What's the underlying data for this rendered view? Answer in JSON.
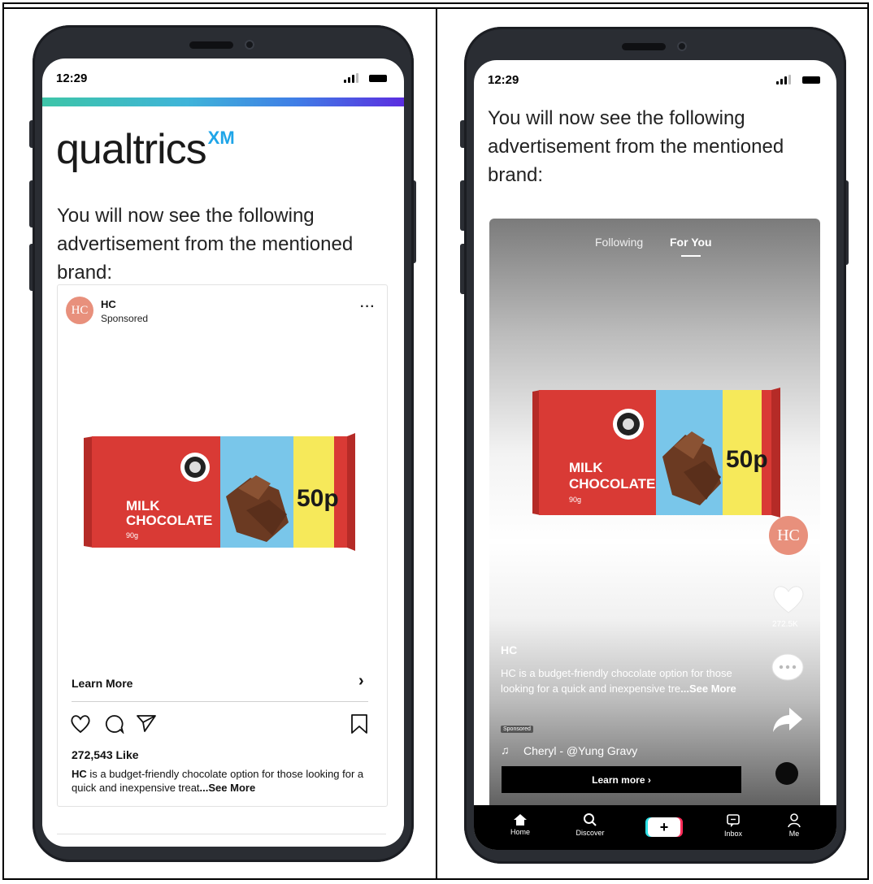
{
  "left_phone": {
    "status_time": "12:29",
    "logo": {
      "word": "qualtrics",
      "superscript": "XM"
    },
    "intro_text": "You will now see the following advertisement from the mentioned brand:",
    "post": {
      "brand_name": "HC",
      "sponsored_label": "Sponsored",
      "avatar_initials": "HC",
      "more_icon": "···",
      "product": {
        "line1": "MILK",
        "line2": "CHOCOLATE",
        "weight": "90g",
        "price": "50p"
      },
      "learn_more": "Learn More",
      "chevron": "›",
      "likes": "272,543 Like",
      "caption_brand": "HC",
      "caption_text": " is a budget-friendly chocolate option for those looking for a quick and inexpensive treat",
      "caption_more": "...See More"
    }
  },
  "right_phone": {
    "status_time": "12:29",
    "intro_text": "You will now see the following advertisement from the mentioned brand:",
    "tabs": {
      "following": "Following",
      "for_you": "For You"
    },
    "product": {
      "line1": "MILK",
      "line2": "CHOCOLATE",
      "weight": "90g",
      "price": "50p"
    },
    "avatar_initials": "HC",
    "like_count": "272.5K",
    "author": "HC",
    "caption": "HC is a budget-friendly chocolate option for those looking for a quick and inexpensive tre",
    "caption_more": "...See More",
    "sponsored_badge": "Sponsored",
    "music": "Cheryl - @Yung Gravy",
    "learn_more": "Learn more ›",
    "nav": {
      "home": "Home",
      "discover": "Discover",
      "inbox": "Inbox",
      "me": "Me"
    }
  },
  "colors": {
    "phone_body": "#2a2d33",
    "avatar": "#e8907c",
    "xm_blue": "#1fa5e8",
    "wrapper_red": "#d93a35",
    "wrapper_blue": "#79c6ea",
    "wrapper_yellow": "#f6e95a"
  }
}
